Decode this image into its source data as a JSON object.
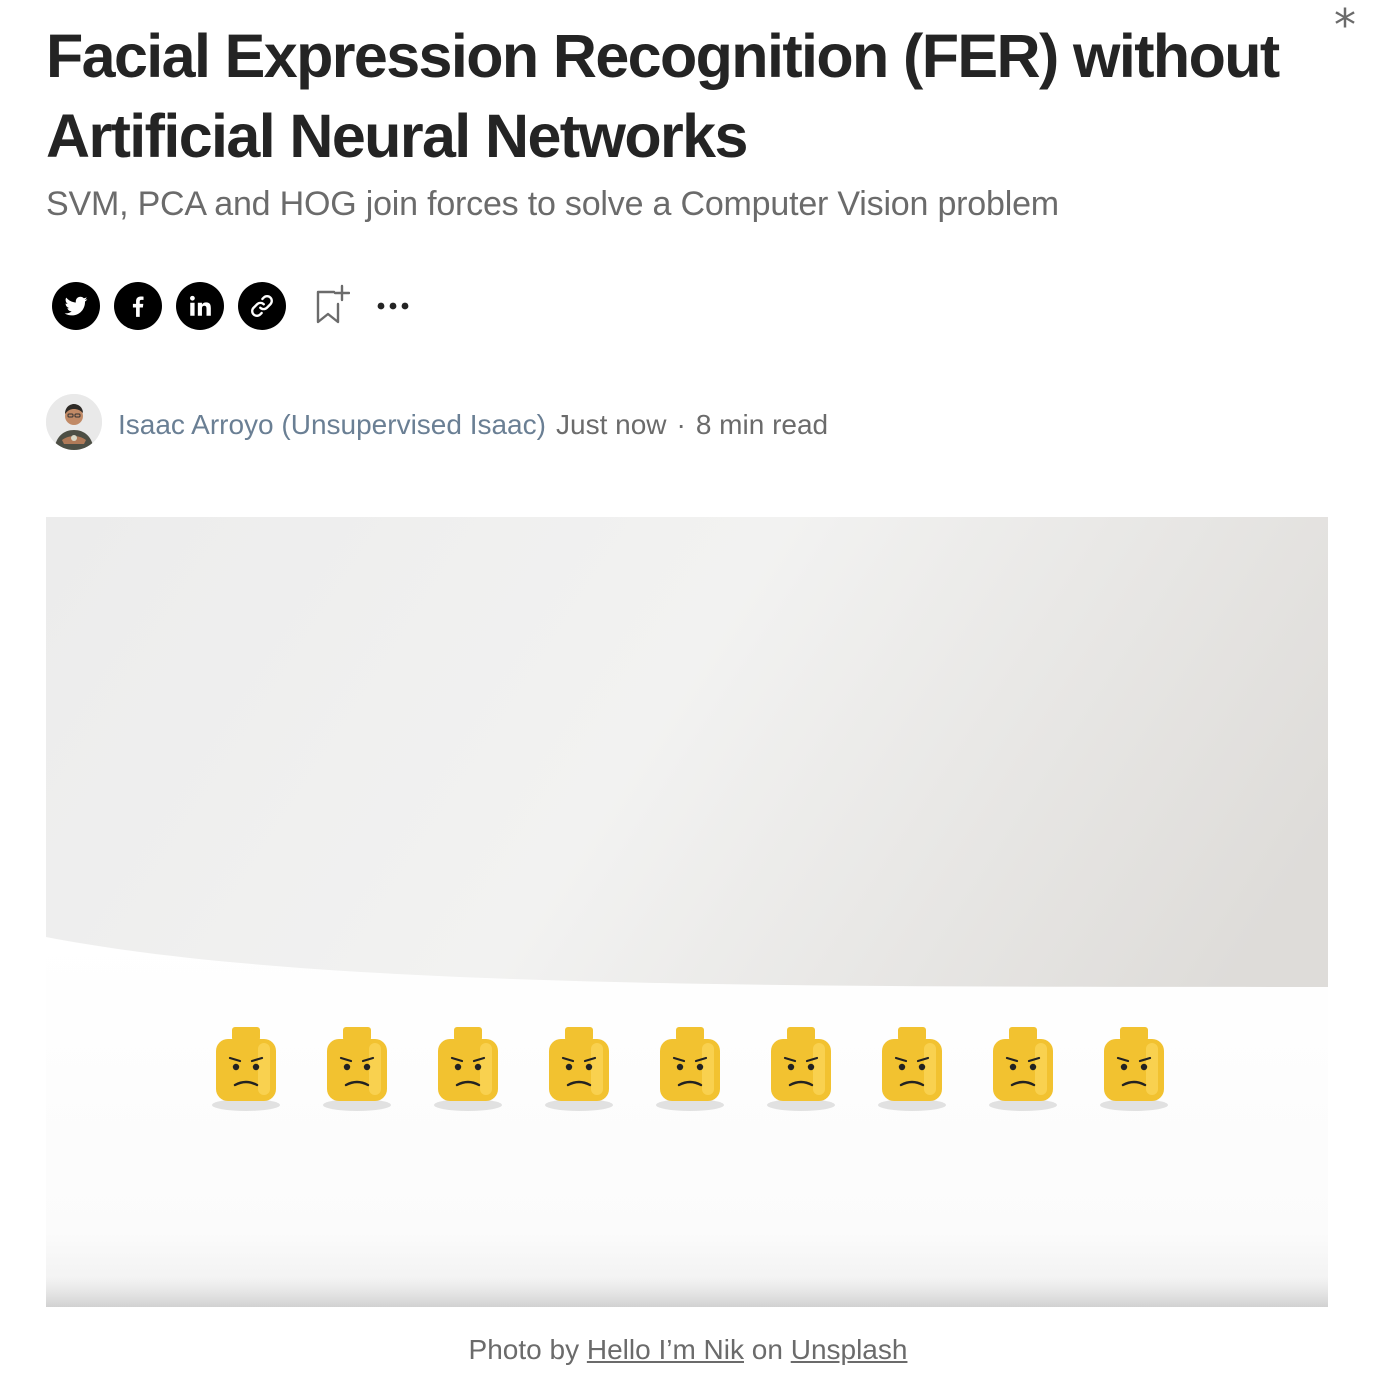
{
  "article": {
    "title": "Facial Expression Recognition (FER) without Artificial Neural Networks",
    "subtitle": "SVM, PCA and HOG join forces to solve a Computer Vision problem"
  },
  "toolbar": {
    "close_glyph": "*",
    "share_icons": [
      "twitter-icon",
      "facebook-icon",
      "linkedin-icon",
      "link-icon"
    ],
    "bookmark_icon": "bookmark-add-icon",
    "more_icon": "more-dots-icon"
  },
  "byline": {
    "author": "Isaac Arroyo (Unsupervised Isaac)",
    "published": "Just now",
    "separator": "·",
    "read_time": "8 min read"
  },
  "hero": {
    "heads": 9,
    "figure_color": "#f2c230"
  },
  "caption": {
    "prefix": "Photo by",
    "photographer": "Hello I’m Nik",
    "middle": "on",
    "source": "Unsplash"
  },
  "colors": {
    "text": "#242424",
    "muted": "#6b6b6b",
    "author_link": "#6a7f94",
    "icon_bg": "#000000"
  }
}
